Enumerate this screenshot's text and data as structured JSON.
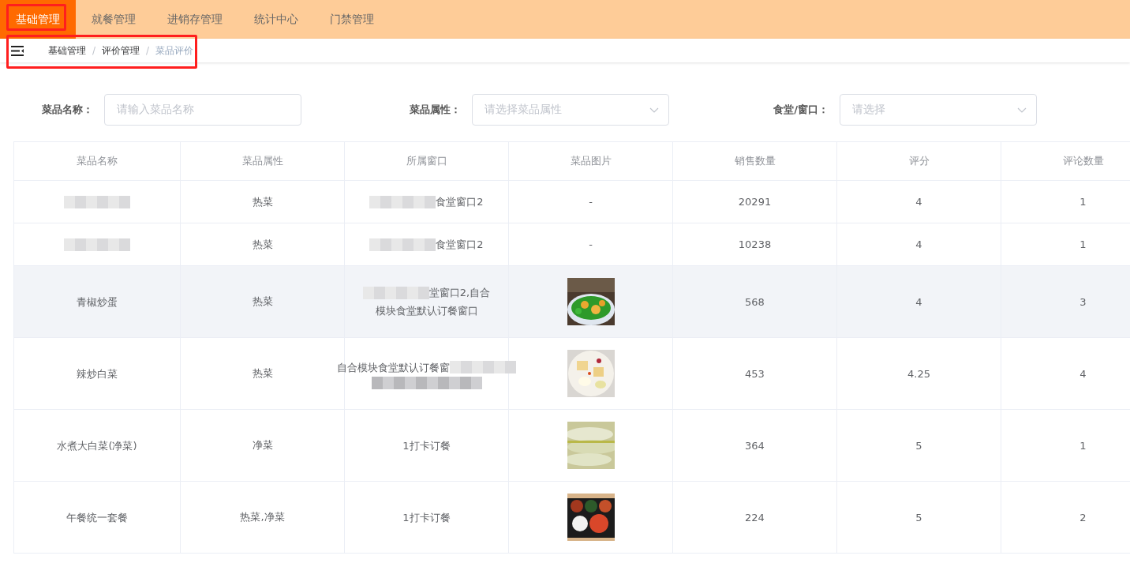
{
  "nav": {
    "tabs": [
      {
        "label": "基础管理",
        "selected": true,
        "annotated": true
      },
      {
        "label": "就餐管理",
        "selected": false,
        "annotated": false
      },
      {
        "label": "进销存管理",
        "selected": false,
        "annotated": false
      },
      {
        "label": "统计中心",
        "selected": false,
        "annotated": false
      },
      {
        "label": "门禁管理",
        "selected": false,
        "annotated": false
      }
    ]
  },
  "breadcrumb": {
    "annotated": true,
    "items": [
      {
        "label": "基础管理",
        "current": false
      },
      {
        "label": "评价管理",
        "current": false
      },
      {
        "label": "菜品评价",
        "current": true
      }
    ],
    "separator": "/"
  },
  "filters": [
    {
      "label": "菜品名称：",
      "kind": "input",
      "placeholder": "请输入菜品名称"
    },
    {
      "label": "菜品属性：",
      "kind": "select",
      "placeholder": "请选择菜品属性"
    },
    {
      "label": "食堂/窗口：",
      "kind": "select",
      "placeholder": "请选择"
    }
  ],
  "table": {
    "columns": [
      "菜品名称",
      "菜品属性",
      "所属窗口",
      "菜品图片",
      "销售数量",
      "评分",
      "评论数量"
    ],
    "rows": [
      {
        "highlighted": false,
        "name": [
          {
            "kind": "mosaic"
          }
        ],
        "attribute": "热菜",
        "window": [
          [
            {
              "kind": "mosaic"
            },
            {
              "kind": "text",
              "text": "食堂窗口2"
            }
          ]
        ],
        "picture": {
          "kind": "none",
          "text": "-"
        },
        "sales": "20291",
        "score": "4",
        "reviews": "1"
      },
      {
        "highlighted": false,
        "name": [
          {
            "kind": "mosaic"
          }
        ],
        "attribute": "热菜",
        "window": [
          [
            {
              "kind": "mosaic"
            },
            {
              "kind": "text",
              "text": "食堂窗口2"
            }
          ]
        ],
        "picture": {
          "kind": "none",
          "text": "-"
        },
        "sales": "10238",
        "score": "4",
        "reviews": "1"
      },
      {
        "highlighted": true,
        "name": [
          {
            "kind": "text",
            "text": "青椒炒蛋"
          }
        ],
        "attribute": "热菜",
        "window": [
          [
            {
              "kind": "mosaic"
            },
            {
              "kind": "text",
              "text": "堂窗口2,自合"
            }
          ],
          [
            {
              "kind": "text",
              "text": "模块食堂默认订餐窗口"
            }
          ]
        ],
        "picture": {
          "kind": "picture"
        },
        "sales": "568",
        "score": "4",
        "reviews": "3"
      },
      {
        "highlighted": false,
        "name": [
          {
            "kind": "text",
            "text": "辣炒白菜"
          }
        ],
        "attribute": "热菜",
        "window": [
          [
            {
              "kind": "text",
              "text": "自合模块食堂默认订餐窗"
            },
            {
              "kind": "mosaic"
            }
          ],
          [
            {
              "kind": "mosaic"
            }
          ]
        ],
        "picture": {
          "kind": "picture"
        },
        "sales": "453",
        "score": "4.25",
        "reviews": "4"
      },
      {
        "highlighted": false,
        "name": [
          {
            "kind": "text",
            "text": "水煮大白菜(净菜)"
          }
        ],
        "attribute": "净菜",
        "window": [
          [
            {
              "kind": "text",
              "text": "1打卡订餐"
            }
          ]
        ],
        "picture": {
          "kind": "picture"
        },
        "sales": "364",
        "score": "5",
        "reviews": "1"
      },
      {
        "highlighted": false,
        "name": [
          {
            "kind": "text",
            "text": "午餐统一套餐"
          }
        ],
        "attribute": "热菜,净菜",
        "window": [
          [
            {
              "kind": "text",
              "text": "1打卡订餐"
            }
          ]
        ],
        "picture": {
          "kind": "picture"
        },
        "sales": "224",
        "score": "5",
        "reviews": "2"
      }
    ]
  }
}
